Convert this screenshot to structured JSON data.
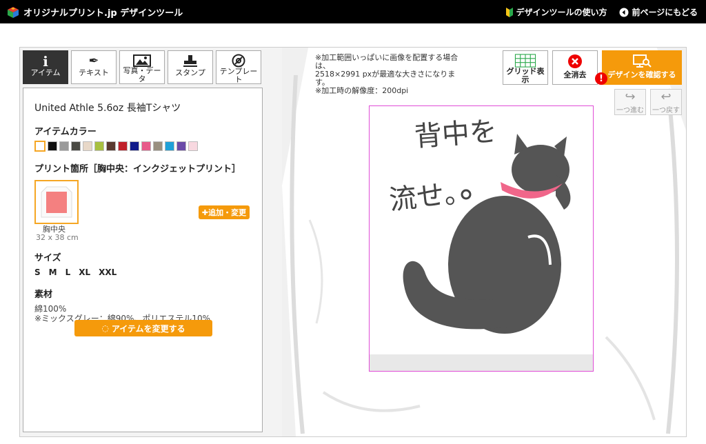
{
  "header": {
    "logo_text": "オリジナルプリント.jp デザインツール",
    "help_link": "デザインツールの使い方",
    "back_link": "前ページにもどる"
  },
  "tool_tabs": [
    {
      "label": "アイテム",
      "icon": "info-icon",
      "active": true
    },
    {
      "label": "テキスト",
      "icon": "pen-icon",
      "active": false
    },
    {
      "label": "写真・データ",
      "icon": "image-icon",
      "active": false
    },
    {
      "label": "スタンプ",
      "icon": "stamp-icon",
      "active": false
    },
    {
      "label": "テンプレート",
      "icon": "template-icon",
      "active": false
    }
  ],
  "panel": {
    "product_name": "United Athle 5.6oz 長袖Tシャツ",
    "color_heading": "アイテムカラー",
    "colors": [
      "#ffffff",
      "#111111",
      "#9a9a9a",
      "#4a4a44",
      "#e8d8c8",
      "#a8c040",
      "#5a3a30",
      "#c0202a",
      "#101a8a",
      "#e85a8a",
      "#9a9080",
      "#1ea0d8",
      "#6a4aa8",
      "#f8d8e0"
    ],
    "print_heading": "プリント箇所［胸中央：インクジェットプリント］",
    "print_area_name": "胸中央",
    "print_area_size": "32 x 38 cm",
    "add_button": "追加・変更",
    "size_heading": "サイズ",
    "sizes": [
      "S",
      "M",
      "L",
      "XL",
      "XXL"
    ],
    "material_heading": "素材",
    "material_line1": "綿100%",
    "material_line2": "※ミックスグレー：綿90%、ポリエステル10%",
    "change_button": "アイテムを変更する"
  },
  "notice": {
    "line1": "※加工範囲いっぱいに画像を配置する場合は、",
    "line2": "2518×2991 pxが最適な大きさになります。",
    "line3": "※加工時の解像度：200dpi"
  },
  "design": {
    "text_line1": "背中を",
    "text_line2": "流せ。"
  },
  "top_right": {
    "grid_label": "グリッド表示",
    "clear_label": "全消去",
    "confirm_label": "デザインを確認する",
    "redo_label": "一つ進む",
    "undo_label": "一つ戻す"
  }
}
